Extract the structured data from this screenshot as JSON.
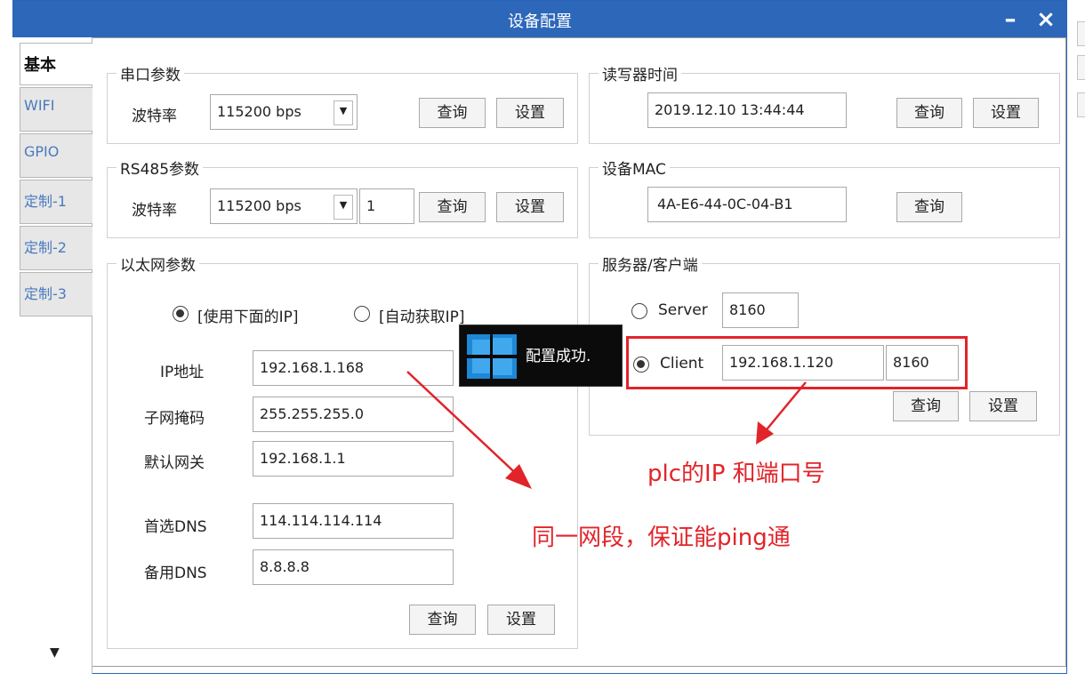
{
  "window": {
    "title": "设备配置",
    "minimize": "–",
    "close": "×"
  },
  "tabs": [
    {
      "label": "基本",
      "active": true
    },
    {
      "label": "WIFI"
    },
    {
      "label": "GPIO"
    },
    {
      "label": "定制-1"
    },
    {
      "label": "定制-2"
    },
    {
      "label": "定制-3"
    }
  ],
  "tab_scroll": "▼",
  "serial": {
    "legend": "串口参数",
    "baud_label": "波特率",
    "baud_value": "115200 bps",
    "query": "查询",
    "set": "设置"
  },
  "rs485": {
    "legend": "RS485参数",
    "baud_label": "波特率",
    "baud_value": "115200 bps",
    "addr_value": "1",
    "query": "查询",
    "set": "设置"
  },
  "ethernet": {
    "legend": "以太网参数",
    "radio_manual": "[使用下面的IP]",
    "radio_auto": "[自动获取IP]",
    "ip_label": "IP地址",
    "ip_value": "192.168.1.168",
    "mask_label": "子网掩码",
    "mask_value": "255.255.255.0",
    "gateway_label": "默认网关",
    "gateway_value": "192.168.1.1",
    "dns1_label": "首选DNS",
    "dns1_value": "114.114.114.114",
    "dns2_label": "备用DNS",
    "dns2_value": "8.8.8.8",
    "query": "查询",
    "set": "设置"
  },
  "reader_time": {
    "legend": "读写器时间",
    "value": "2019.12.10 13:44:44",
    "query": "查询",
    "set": "设置"
  },
  "mac": {
    "legend": "设备MAC",
    "value": "4A-E6-44-0C-04-B1",
    "query": "查询"
  },
  "server_client": {
    "legend": "服务器/客户端",
    "server_label": "Server",
    "server_port": "8160",
    "client_label": "Client",
    "client_ip": "192.168.1.120",
    "client_port": "8160",
    "query": "查询",
    "set": "设置"
  },
  "toast": {
    "text": "配置成功."
  },
  "annotations": {
    "plc": "plc的IP 和端口号",
    "segment": "同一网段，保证能ping通"
  },
  "colors": {
    "titlebar": "#2d67ba",
    "annotation_red": "#e1242a"
  }
}
